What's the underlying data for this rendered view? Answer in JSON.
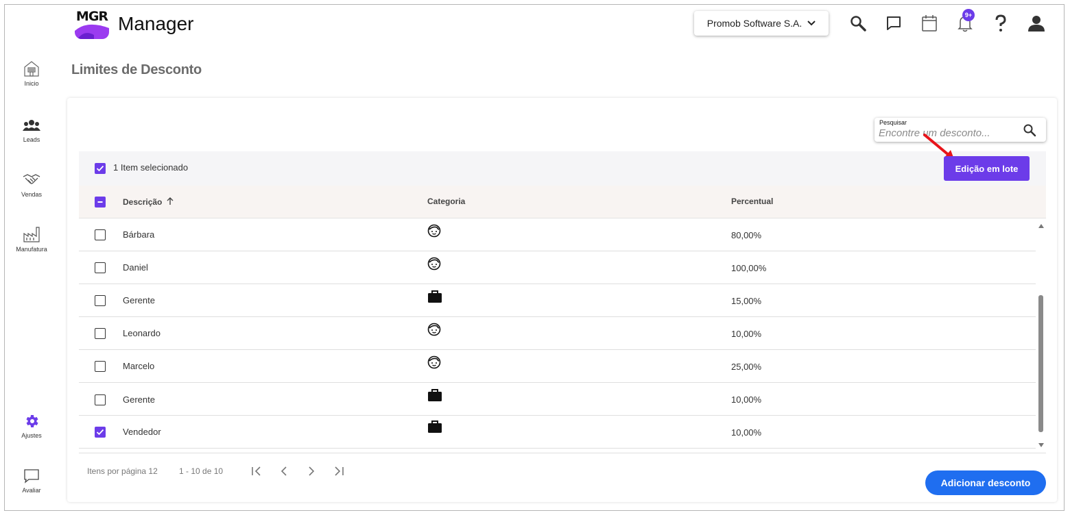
{
  "header": {
    "logo_text": "MGR",
    "app_name": "Manager",
    "company": "Promob Software S.A.",
    "notifications_badge": "9+",
    "icons": [
      "search-icon",
      "chat-icon",
      "calendar-icon",
      "bell-icon",
      "help-icon",
      "user-icon"
    ]
  },
  "sidebar": {
    "items": [
      {
        "label": "Inicio",
        "icon": "home-icon"
      },
      {
        "label": "Leads",
        "icon": "people-icon"
      },
      {
        "label": "Vendas",
        "icon": "handshake-icon"
      },
      {
        "label": "Manufatura",
        "icon": "factory-icon"
      },
      {
        "label": "Ajustes",
        "icon": "gear-icon"
      },
      {
        "label": "Avaliar",
        "icon": "feedback-icon"
      }
    ]
  },
  "page": {
    "title": "Limites de Desconto"
  },
  "search": {
    "label": "Pesquisar",
    "placeholder": "Encontre um desconto..."
  },
  "selection": {
    "text": "1 Item selecionado",
    "batch_button": "Edição em lote"
  },
  "table": {
    "columns": [
      "Descrição",
      "Categoria",
      "Percentual"
    ],
    "rows": [
      {
        "descricao": "Bárbara",
        "categoria": "person-icon",
        "percentual": "80,00%",
        "checked": false
      },
      {
        "descricao": "Daniel",
        "categoria": "person-icon",
        "percentual": "100,00%",
        "checked": false
      },
      {
        "descricao": "Gerente",
        "categoria": "briefcase-icon",
        "percentual": "15,00%",
        "checked": false
      },
      {
        "descricao": "Leonardo",
        "categoria": "person-icon",
        "percentual": "10,00%",
        "checked": false
      },
      {
        "descricao": "Marcelo",
        "categoria": "person-icon",
        "percentual": "25,00%",
        "checked": false
      },
      {
        "descricao": "Gerente",
        "categoria": "briefcase-icon",
        "percentual": "10,00%",
        "checked": false
      },
      {
        "descricao": "Vendedor",
        "categoria": "briefcase-icon",
        "percentual": "10,00%",
        "checked": true
      }
    ]
  },
  "pagination": {
    "items_per_page": "Itens por página 12",
    "range": "1 - 10 de 10"
  },
  "add_button": "Adicionar desconto",
  "colors": {
    "accent": "#6c3ce9",
    "primary_button": "#1f6ef0"
  }
}
